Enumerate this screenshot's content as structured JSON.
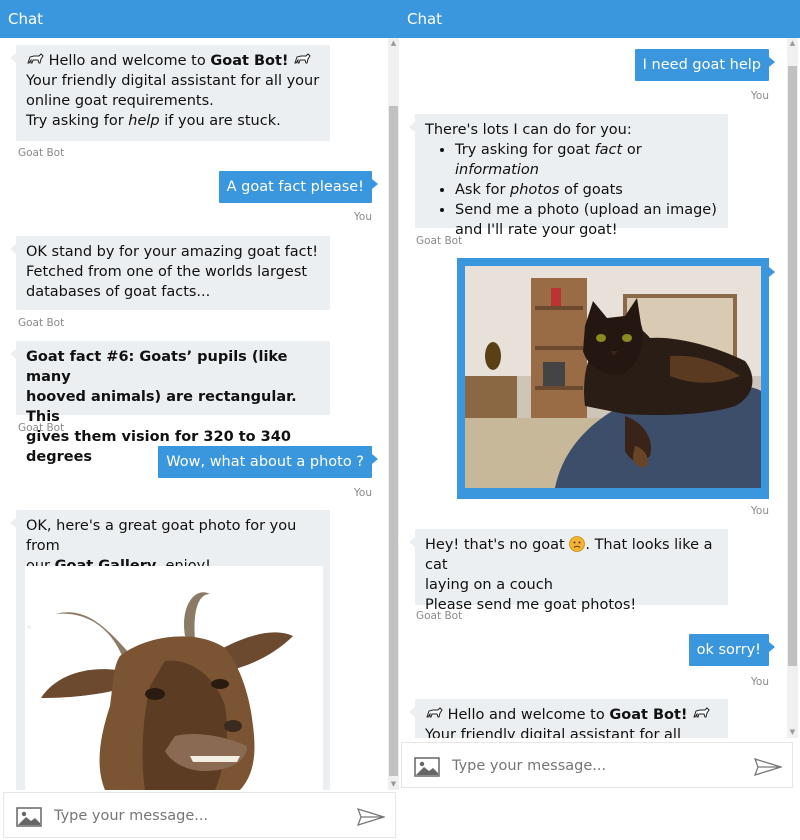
{
  "left": {
    "header": "Chat",
    "messages": {
      "welcome_hello": "Hello and welcome to ",
      "welcome_bot_name": "Goat Bot!",
      "welcome_line2": "Your friendly digital assistant for all your",
      "welcome_line3": "online goat requirements.",
      "welcome_line4a": "Try asking for ",
      "welcome_line4b": "help",
      "welcome_line4c": " if you are stuck.",
      "sender_bot": "Goat Bot",
      "user_fact": "A goat fact please!",
      "sender_you": "You",
      "standby_1": "OK stand by for your amazing goat fact!",
      "standby_2": "Fetched from one of the worlds largest",
      "standby_3": "databases of goat facts...",
      "fact_1": "Goat fact #6: Goats’ pupils (like many",
      "fact_2": "hooved animals) are rectangular. This",
      "fact_3": "gives them vision for 320 to 340 degrees",
      "user_photo": "Wow, what about a photo ?",
      "gallery_1": "OK, here's a great goat photo for you from",
      "gallery_2a": "our ",
      "gallery_2b": "Goat Gallery",
      "gallery_2c": ", enjoy!"
    },
    "input_placeholder": "Type your message..."
  },
  "right": {
    "header": "Chat",
    "messages": {
      "user_help": "I need goat help",
      "sender_you": "You",
      "help_intro": "There's lots I can do for you:",
      "help_item1a": "Try asking for goat ",
      "help_item1b": "fact",
      "help_item1c": " or ",
      "help_item1d": "information",
      "help_item2a": "Ask for ",
      "help_item2b": "photos",
      "help_item2c": " of goats",
      "help_item3a": "Send me a photo (upload an image)",
      "help_item3b": "and I'll rate your goat!",
      "sender_bot": "Goat Bot",
      "nogoat_1a": "Hey! that's no goat ",
      "nogoat_1b": ". That looks like a cat",
      "nogoat_2": "laying on a couch",
      "nogoat_3": "Please send me goat photos!",
      "user_sorry": "ok sorry!",
      "welcome_hello": "Hello and welcome to ",
      "welcome_bot_name": "Goat Bot!",
      "welcome_line2": "Your friendly digital assistant for all your"
    },
    "input_placeholder": "Type your message..."
  },
  "colors": {
    "accent": "#3a96dd",
    "bot_bubble": "#eceff1",
    "sender_text": "#8a8a8a"
  }
}
